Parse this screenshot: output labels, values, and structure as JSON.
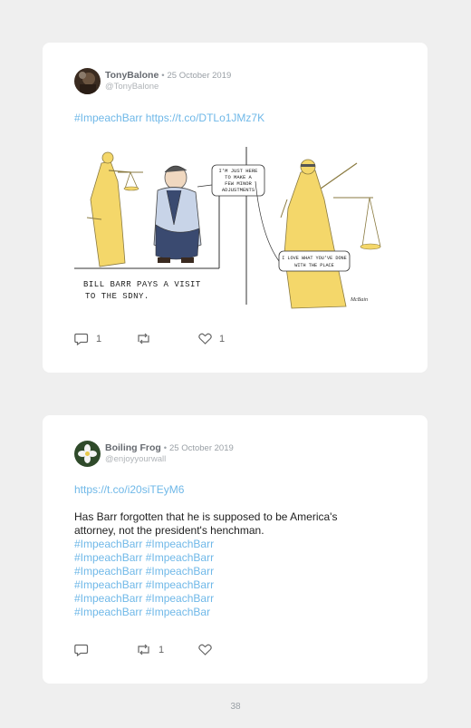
{
  "tweets": [
    {
      "name": "TonyBalone",
      "separator": "•",
      "date": "25 October 2019",
      "handle": "@TonyBalone",
      "hashtag": "#ImpeachBarr",
      "link": "https://t.co/DTLo1JMz7K",
      "image": {
        "bubble_top": [
          "I'M JUST HERE",
          "TO MAKE A",
          "FEW MINOR",
          "ADJUSTMENTS"
        ],
        "bubble_bottom": [
          "I LOVE WHAT YOU'VE DONE",
          "WITH THE PLACE"
        ],
        "caption_line1": "BILL BARR PAYS A VISIT",
        "caption_line2": "TO THE SDNY.",
        "signature": "McBain"
      },
      "actions": {
        "replies": "1",
        "retweets": "",
        "likes": "1"
      }
    },
    {
      "name": "Boiling Frog",
      "separator": "•",
      "date": "25 October 2019",
      "handle": "@enjoyyourwall",
      "link": "https://t.co/i20siTEyM6",
      "text_line1": "Has Barr forgotten that he is supposed to be America's",
      "text_line2": "attorney, not the president's henchman.",
      "hashtag_lines": [
        "#ImpeachBarr #ImpeachBarr",
        "#ImpeachBarr #ImpeachBarr",
        "#ImpeachBarr #ImpeachBarr",
        "#ImpeachBarr #ImpeachBarr",
        "#ImpeachBarr #ImpeachBarr",
        "#ImpeachBarr #ImpeachBar"
      ],
      "actions": {
        "replies": "",
        "retweets": "1",
        "likes": ""
      }
    }
  ],
  "page_number": "38",
  "colors": {
    "link": "#6fb8e8",
    "name": "#666a70",
    "meta": "#9aa0a6",
    "card": "#ffffff",
    "background": "#efefef"
  }
}
